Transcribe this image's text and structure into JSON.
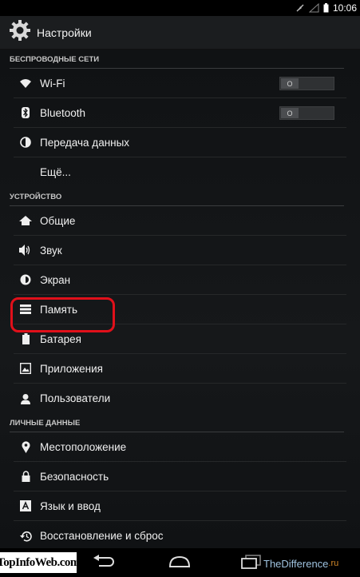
{
  "status": {
    "time": "10:06"
  },
  "header": {
    "title": "Настройки",
    "icon": "gear-icon"
  },
  "sections": {
    "wireless": {
      "title": "БЕСПРОВОДНЫЕ СЕТИ",
      "wifi": {
        "label": "Wi-Fi",
        "toggle": "O"
      },
      "bluetooth": {
        "label": "Bluetooth",
        "toggle": "O"
      },
      "data_usage": {
        "label": "Передача данных"
      },
      "more": {
        "label": "Ещё..."
      }
    },
    "device": {
      "title": "УСТРОЙСТВО",
      "general": {
        "label": "Общие"
      },
      "sound": {
        "label": "Звук"
      },
      "display": {
        "label": "Экран"
      },
      "storage": {
        "label": "Память"
      },
      "battery": {
        "label": "Батарея"
      },
      "apps": {
        "label": "Приложения"
      },
      "users": {
        "label": "Пользователи"
      }
    },
    "personal": {
      "title": "ЛИЧНЫЕ ДАННЫЕ",
      "location": {
        "label": "Местоположение"
      },
      "security": {
        "label": "Безопасность"
      },
      "language": {
        "label": "Язык и ввод"
      },
      "backup": {
        "label": "Восстановление и сброс"
      }
    }
  },
  "watermarks": {
    "left": "TopInfoWeb.com",
    "right_main": "TheDifference",
    "right_tld": ".ru"
  },
  "colors": {
    "highlight": "#e0101a",
    "background": "#131517"
  }
}
